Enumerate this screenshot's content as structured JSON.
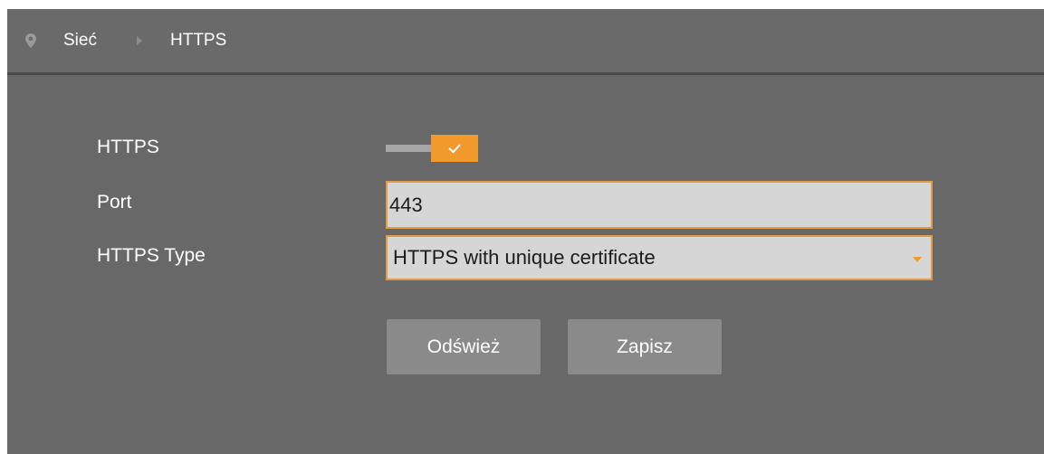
{
  "breadcrumb": {
    "items": [
      "Sieć",
      "HTTPS"
    ]
  },
  "form": {
    "https": {
      "label": "HTTPS",
      "enabled": true
    },
    "port": {
      "label": "Port",
      "value": "443"
    },
    "https_type": {
      "label": "HTTPS Type",
      "selected": "HTTPS with unique certificate"
    }
  },
  "buttons": {
    "refresh_label": "Odśwież",
    "save_label": "Zapisz"
  },
  "colors": {
    "accent": "#f2992e",
    "panel_bg": "#686868",
    "field_bg": "#d6d6d6",
    "button_bg": "#8a8a8a"
  },
  "icons": {
    "breadcrumb_pin": "location-pin-icon",
    "breadcrumb_separator": "chevron-right-icon",
    "toggle_check": "checkmark-icon",
    "select_caret": "caret-down-icon"
  }
}
